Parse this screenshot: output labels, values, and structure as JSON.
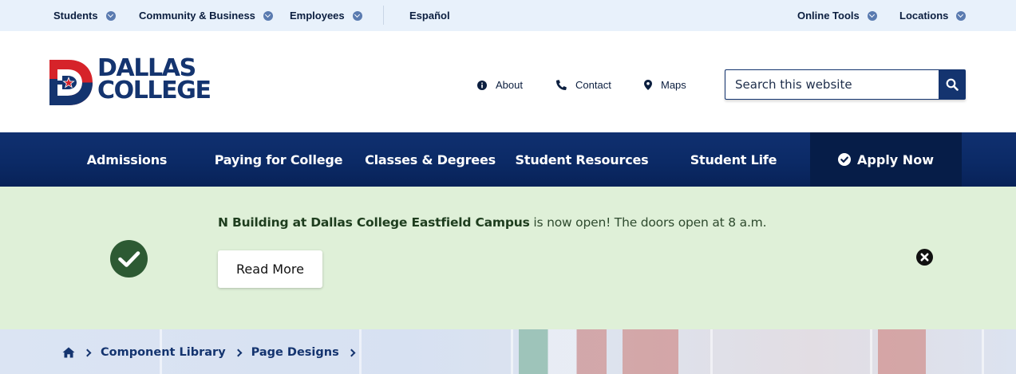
{
  "utility": {
    "left_items": [
      {
        "label": "Students"
      },
      {
        "label": "Community & Business"
      },
      {
        "label": "Employees"
      }
    ],
    "language": "Español",
    "right_items": [
      {
        "label": "Online Tools"
      },
      {
        "label": "Locations"
      }
    ]
  },
  "brand": {
    "line1": "DALLAS",
    "line2": "COLLEGE",
    "colors": {
      "navy": "#14346f",
      "red": "#d6232a"
    }
  },
  "header": {
    "links": [
      {
        "label": "About",
        "icon": "info-icon"
      },
      {
        "label": "Contact",
        "icon": "phone-icon"
      },
      {
        "label": "Maps",
        "icon": "map-marker-icon"
      }
    ],
    "search": {
      "placeholder": "Search this website"
    }
  },
  "nav": {
    "items": [
      {
        "label": "Admissions"
      },
      {
        "label": "Paying for College"
      },
      {
        "label": "Classes & Degrees"
      },
      {
        "label": "Student Resources"
      },
      {
        "label": "Student Life"
      }
    ],
    "apply_label": "Apply Now"
  },
  "alert": {
    "bold_text": "N Building at Dallas College Eastfield Campus",
    "text": " is now open! The doors open at 8 a.m.",
    "button_label": "Read More",
    "colors": {
      "background": "#dff0d8",
      "icon": "#2d5a33"
    }
  },
  "breadcrumb": {
    "items": [
      {
        "label": "Component Library"
      },
      {
        "label": "Page Designs"
      }
    ]
  }
}
